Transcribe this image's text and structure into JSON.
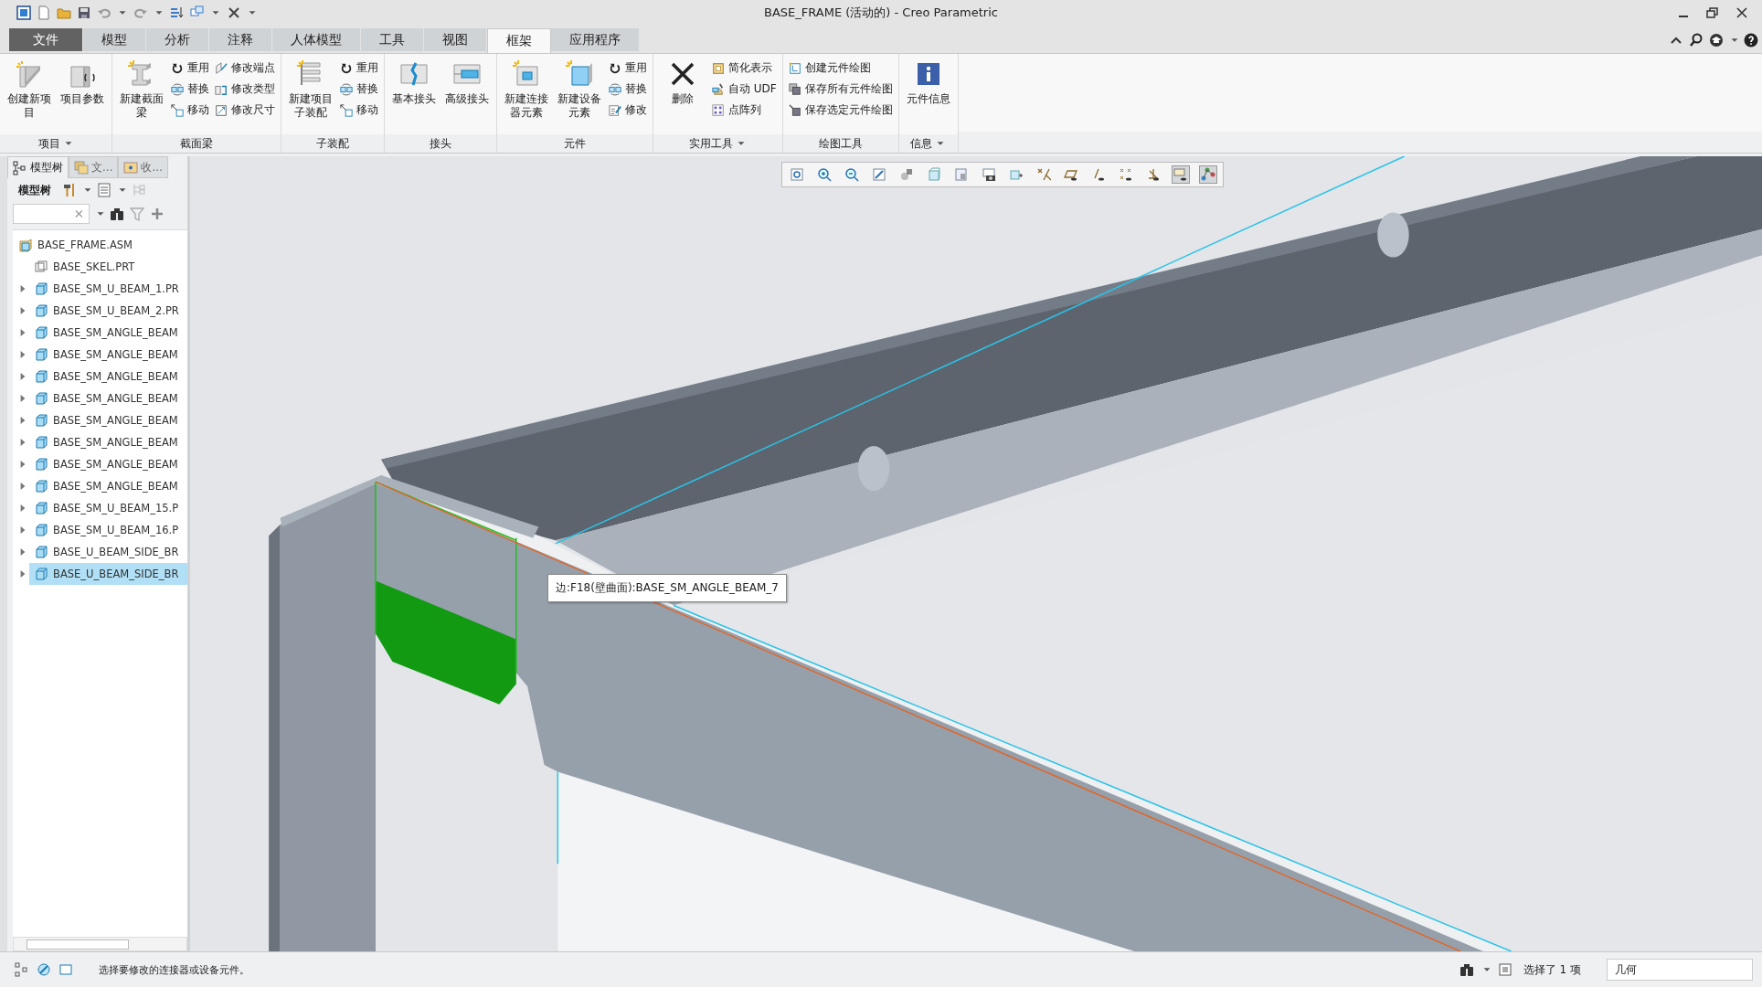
{
  "window": {
    "title": "BASE_FRAME (活动的) - Creo Parametric"
  },
  "tabs": [
    {
      "label": "文件",
      "kind": "file",
      "selected": false
    },
    {
      "label": "模型",
      "kind": "tab",
      "selected": false
    },
    {
      "label": "分析",
      "kind": "tab",
      "selected": false
    },
    {
      "label": "注释",
      "kind": "tab",
      "selected": false
    },
    {
      "label": "人体模型",
      "kind": "tab",
      "selected": false
    },
    {
      "label": "工具",
      "kind": "tab",
      "selected": false
    },
    {
      "label": "视图",
      "kind": "tab",
      "selected": false
    },
    {
      "label": "框架",
      "kind": "tab",
      "selected": true
    },
    {
      "label": "应用程序",
      "kind": "tab",
      "selected": false
    }
  ],
  "ribbon": [
    {
      "label": "项目",
      "dropdown": true,
      "items": [
        {
          "kind": "large",
          "label": "创建新项目"
        },
        {
          "kind": "large",
          "label": "项目参数"
        }
      ]
    },
    {
      "label": "截面梁",
      "dropdown": false,
      "items": [
        {
          "kind": "large",
          "label": "新建截面梁"
        },
        {
          "kind": "small",
          "label": "重用"
        },
        {
          "kind": "small",
          "label": "替换"
        },
        {
          "kind": "small",
          "label": "移动"
        },
        {
          "kind": "small",
          "label": "修改端点"
        },
        {
          "kind": "small",
          "label": "修改类型"
        },
        {
          "kind": "small",
          "label": "修改尺寸"
        }
      ]
    },
    {
      "label": "子装配",
      "dropdown": false,
      "items": [
        {
          "kind": "large",
          "label": "新建项目子装配"
        },
        {
          "kind": "small",
          "label": "重用"
        },
        {
          "kind": "small",
          "label": "替换"
        },
        {
          "kind": "small",
          "label": "移动"
        }
      ]
    },
    {
      "label": "接头",
      "dropdown": false,
      "items": [
        {
          "kind": "large",
          "label": "基本接头"
        },
        {
          "kind": "large",
          "label": "高级接头"
        }
      ]
    },
    {
      "label": "元件",
      "dropdown": false,
      "items": [
        {
          "kind": "large",
          "label": "新建连接器元素"
        },
        {
          "kind": "large",
          "label": "新建设备元素"
        },
        {
          "kind": "small",
          "label": "重用"
        },
        {
          "kind": "small",
          "label": "替换"
        },
        {
          "kind": "small",
          "label": "修改"
        }
      ]
    },
    {
      "label": "实用工具",
      "dropdown": true,
      "items": [
        {
          "kind": "large",
          "label": "删除"
        },
        {
          "kind": "small",
          "label": "简化表示"
        },
        {
          "kind": "small",
          "label": "自动 UDF"
        },
        {
          "kind": "small",
          "label": "点阵列"
        }
      ]
    },
    {
      "label": "绘图工具",
      "dropdown": false,
      "items": [
        {
          "kind": "small",
          "label": "创建元件绘图"
        },
        {
          "kind": "small",
          "label": "保存所有元件绘图"
        },
        {
          "kind": "small",
          "label": "保存选定元件绘图"
        }
      ]
    },
    {
      "label": "信息",
      "dropdown": true,
      "items": [
        {
          "kind": "large",
          "label": "元件信息"
        }
      ]
    }
  ],
  "panel_tabs": [
    {
      "label": "模型树",
      "selected": true
    },
    {
      "label": "文...",
      "selected": false
    },
    {
      "label": "收...",
      "selected": false
    }
  ],
  "tree_toolbar": {
    "label": "模型树"
  },
  "tree": [
    {
      "label": "BASE_FRAME.ASM",
      "kind": "assembly",
      "expandable": false,
      "selected": false,
      "children": [
        {
          "label": "BASE_SKEL.PRT",
          "kind": "skeleton",
          "expandable": false,
          "selected": false
        },
        {
          "label": "BASE_SM_U_BEAM_1.PR",
          "kind": "part",
          "expandable": true,
          "selected": false
        },
        {
          "label": "BASE_SM_U_BEAM_2.PR",
          "kind": "part",
          "expandable": true,
          "selected": false
        },
        {
          "label": "BASE_SM_ANGLE_BEAM",
          "kind": "part",
          "expandable": true,
          "selected": false
        },
        {
          "label": "BASE_SM_ANGLE_BEAM",
          "kind": "part",
          "expandable": true,
          "selected": false
        },
        {
          "label": "BASE_SM_ANGLE_BEAM",
          "kind": "part",
          "expandable": true,
          "selected": false
        },
        {
          "label": "BASE_SM_ANGLE_BEAM",
          "kind": "part",
          "expandable": true,
          "selected": false
        },
        {
          "label": "BASE_SM_ANGLE_BEAM",
          "kind": "part",
          "expandable": true,
          "selected": false
        },
        {
          "label": "BASE_SM_ANGLE_BEAM",
          "kind": "part",
          "expandable": true,
          "selected": false
        },
        {
          "label": "BASE_SM_ANGLE_BEAM",
          "kind": "part",
          "expandable": true,
          "selected": false
        },
        {
          "label": "BASE_SM_ANGLE_BEAM",
          "kind": "part",
          "expandable": true,
          "selected": false
        },
        {
          "label": "BASE_SM_U_BEAM_15.P",
          "kind": "part",
          "expandable": true,
          "selected": false
        },
        {
          "label": "BASE_SM_U_BEAM_16.P",
          "kind": "part",
          "expandable": true,
          "selected": false
        },
        {
          "label": "BASE_U_BEAM_SIDE_BR",
          "kind": "part",
          "expandable": true,
          "selected": false
        },
        {
          "label": "BASE_U_BEAM_SIDE_BR",
          "kind": "part",
          "expandable": true,
          "selected": true
        }
      ]
    }
  ],
  "tooltip": "边:F18(壁曲面):BASE_SM_ANGLE_BEAM_7",
  "status_bar": {
    "message": "选择要修改的连接器或设备元件。",
    "selection": "选择了 1 项",
    "filter": "几何"
  }
}
